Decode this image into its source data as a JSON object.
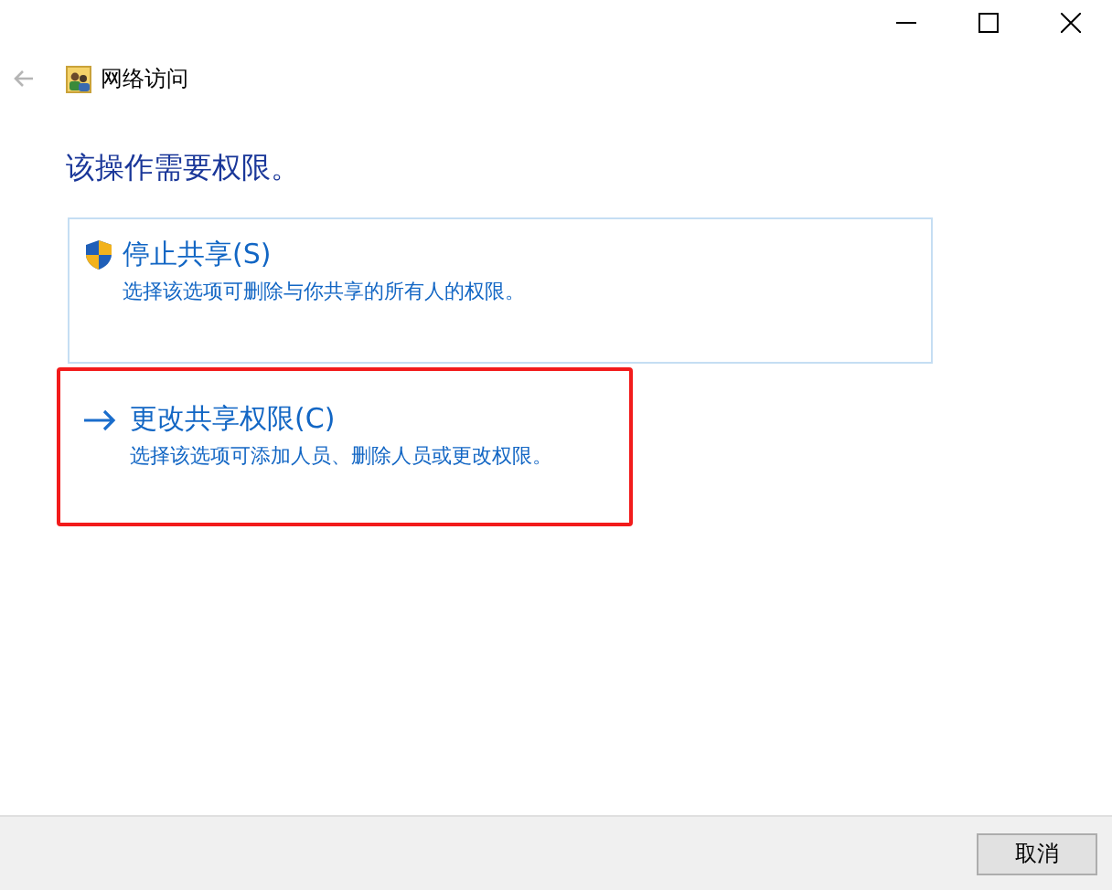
{
  "window": {
    "title": "网络访问"
  },
  "heading": "该操作需要权限。",
  "options": [
    {
      "kind": "shield",
      "title": "停止共享(S)",
      "description": "选择该选项可删除与你共享的所有人的权限。",
      "hovered": true,
      "annotated": false
    },
    {
      "kind": "arrow",
      "title": "更改共享权限(C)",
      "description": "选择该选项可添加人员、删除人员或更改权限。",
      "hovered": false,
      "annotated": true
    }
  ],
  "buttons": [
    "取消"
  ]
}
